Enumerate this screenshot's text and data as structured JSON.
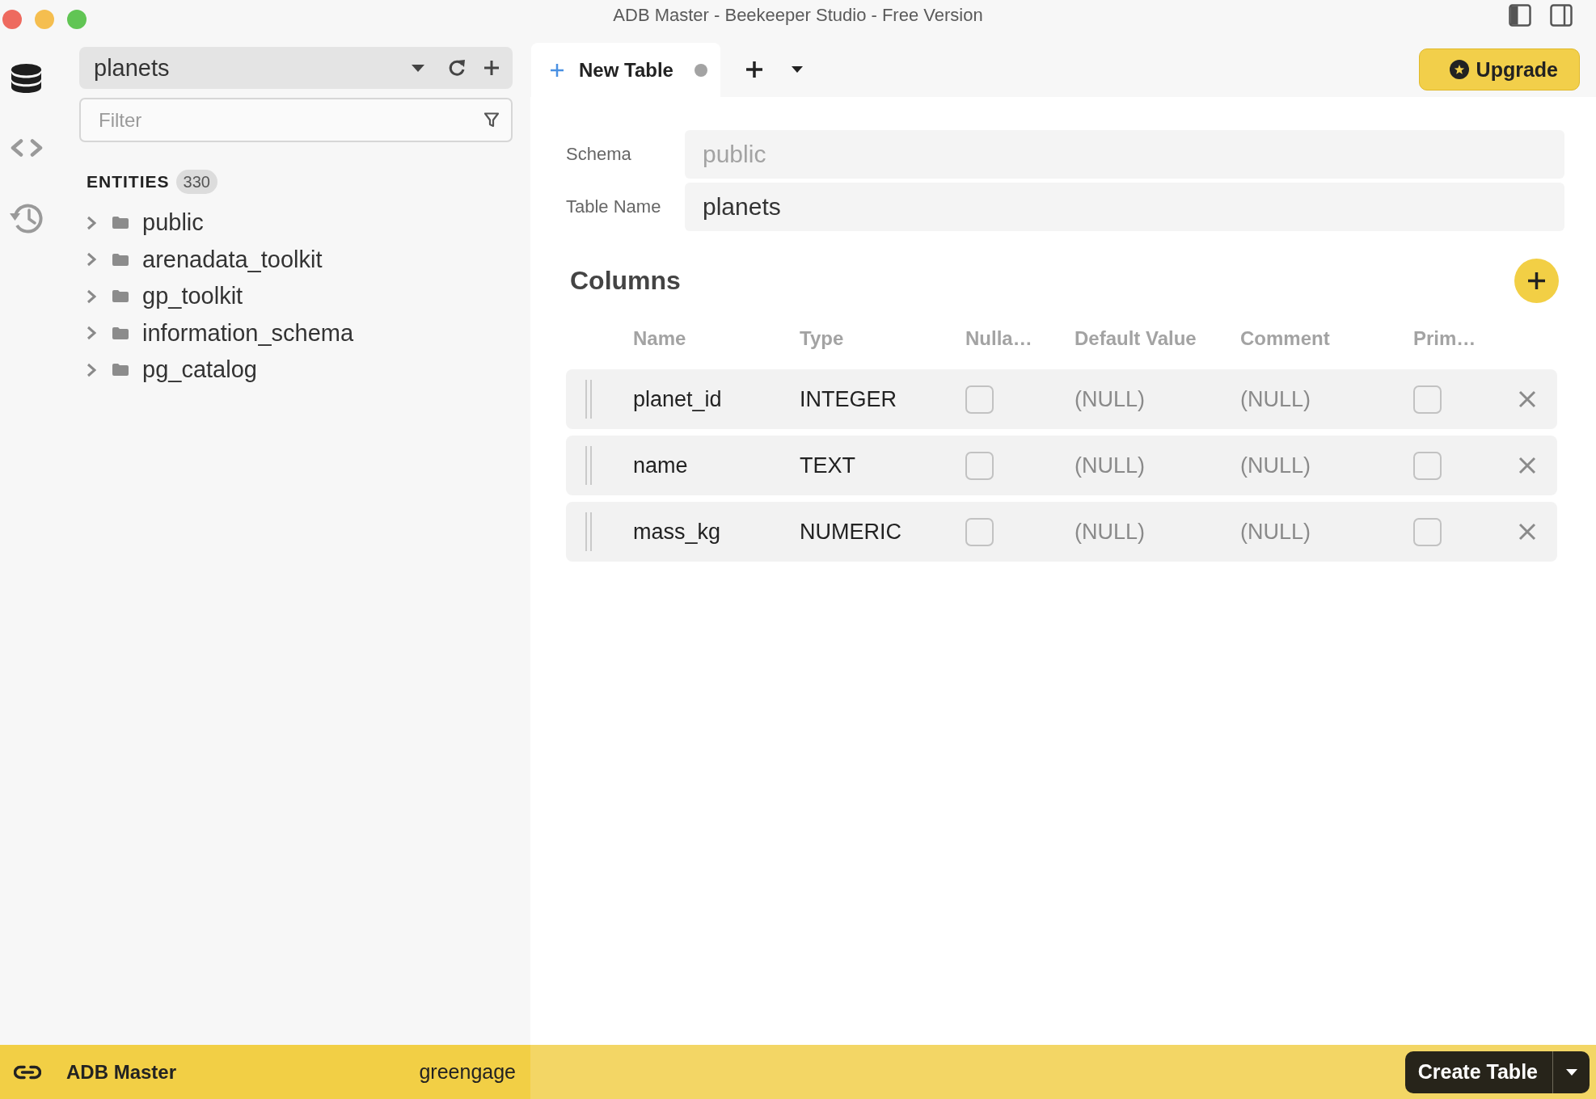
{
  "window": {
    "title": "ADB Master - Beekeeper Studio - Free Version"
  },
  "rail": [
    {
      "kind": "database",
      "selected": true
    },
    {
      "kind": "code",
      "selected": false
    },
    {
      "kind": "history",
      "selected": false
    }
  ],
  "sidebar": {
    "connection": "planets",
    "filter": {
      "placeholder": "Filter"
    },
    "entities": {
      "label": "ENTITIES",
      "count": "330"
    },
    "tree": [
      {
        "name": "public",
        "expanded": false
      },
      {
        "name": "arenadata_toolkit",
        "expanded": false
      },
      {
        "name": "gp_toolkit",
        "expanded": false
      },
      {
        "name": "information_schema",
        "expanded": false
      },
      {
        "name": "pg_catalog",
        "expanded": false
      }
    ]
  },
  "tabs": [
    {
      "label": "New Table",
      "selected": true,
      "unsaved": true
    }
  ],
  "upgrade_button": {
    "label": "Upgrade"
  },
  "form": {
    "fields": [
      {
        "label": "Schema",
        "value": "public",
        "disabled": true
      },
      {
        "label": "Table Name",
        "value": "planets",
        "disabled": false
      }
    ]
  },
  "columns": {
    "title": "Columns",
    "headers": [
      "Name",
      "Type",
      "Nulla…",
      "Default Value",
      "Comment",
      "Prim…"
    ],
    "rows": [
      {
        "name": "planet_id",
        "type": "INTEGER",
        "nullable": false,
        "default": "(NULL)",
        "comment": "(NULL)",
        "primary": false
      },
      {
        "name": "name",
        "type": "TEXT",
        "nullable": false,
        "default": "(NULL)",
        "comment": "(NULL)",
        "primary": false
      },
      {
        "name": "mass_kg",
        "type": "NUMERIC",
        "nullable": false,
        "default": "(NULL)",
        "comment": "(NULL)",
        "primary": false
      }
    ]
  },
  "status_bar": {
    "connection": "ADB Master",
    "database": "greengage",
    "action": "Create Table"
  }
}
